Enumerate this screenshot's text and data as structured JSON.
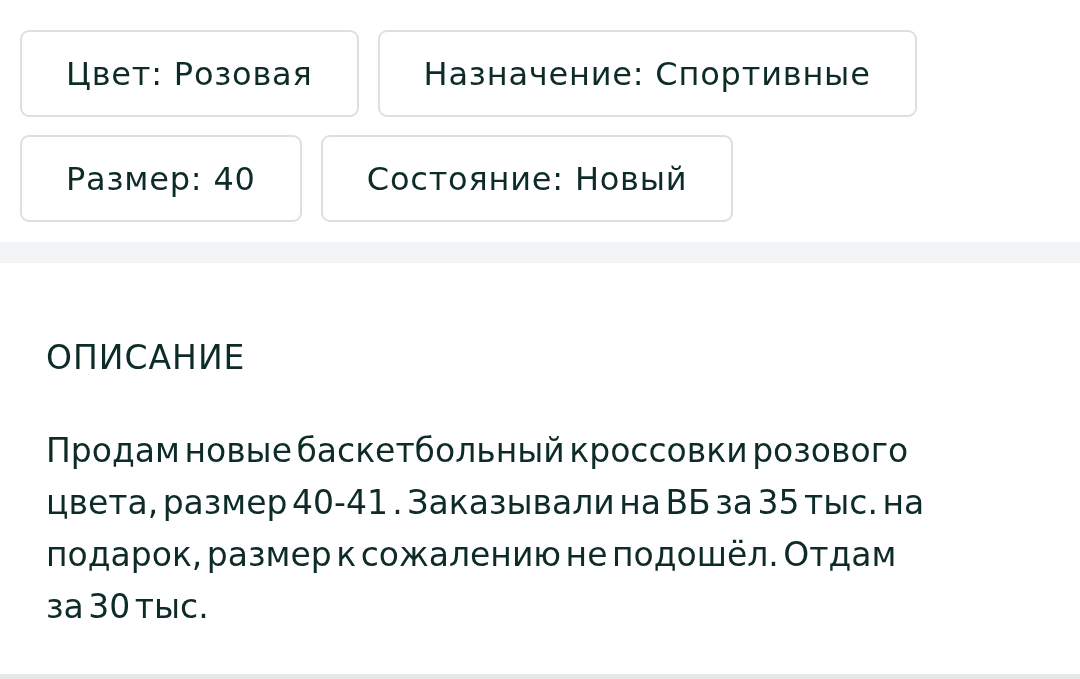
{
  "attributes": [
    {
      "label": "Цвет: Розовая"
    },
    {
      "label": "Назначение: Спортивные"
    },
    {
      "label": "Размер: 40"
    },
    {
      "label": "Состояние: Новый"
    }
  ],
  "description": {
    "heading": "ОПИСАНИЕ",
    "text": "Продам новые баскетбольный кроссовки розового цвета, размер 40-41 . Заказывали на ВБ за 35 тыс. на подарок, размер к сожалению не подошёл. Отдам за 30 тыс."
  }
}
